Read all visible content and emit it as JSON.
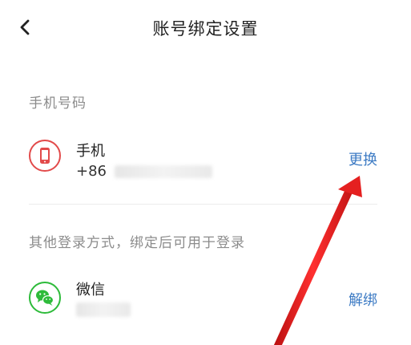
{
  "header": {
    "title": "账号绑定设置",
    "back_icon": "chevron-left-icon"
  },
  "phone_section": {
    "label": "手机号码",
    "item": {
      "icon": "mobile-phone-icon",
      "icon_color": "#e24a4a",
      "title": "手机",
      "value_prefix": "+86",
      "action_label": "更换"
    }
  },
  "other_section": {
    "label": "其他登录方式，绑定后可用于登录",
    "item": {
      "icon": "wechat-icon",
      "icon_color": "#2dbb3a",
      "title": "微信",
      "action_label": "解绑"
    }
  },
  "colors": {
    "action": "#3d7bc4",
    "annotation_arrow": "#e52020"
  }
}
